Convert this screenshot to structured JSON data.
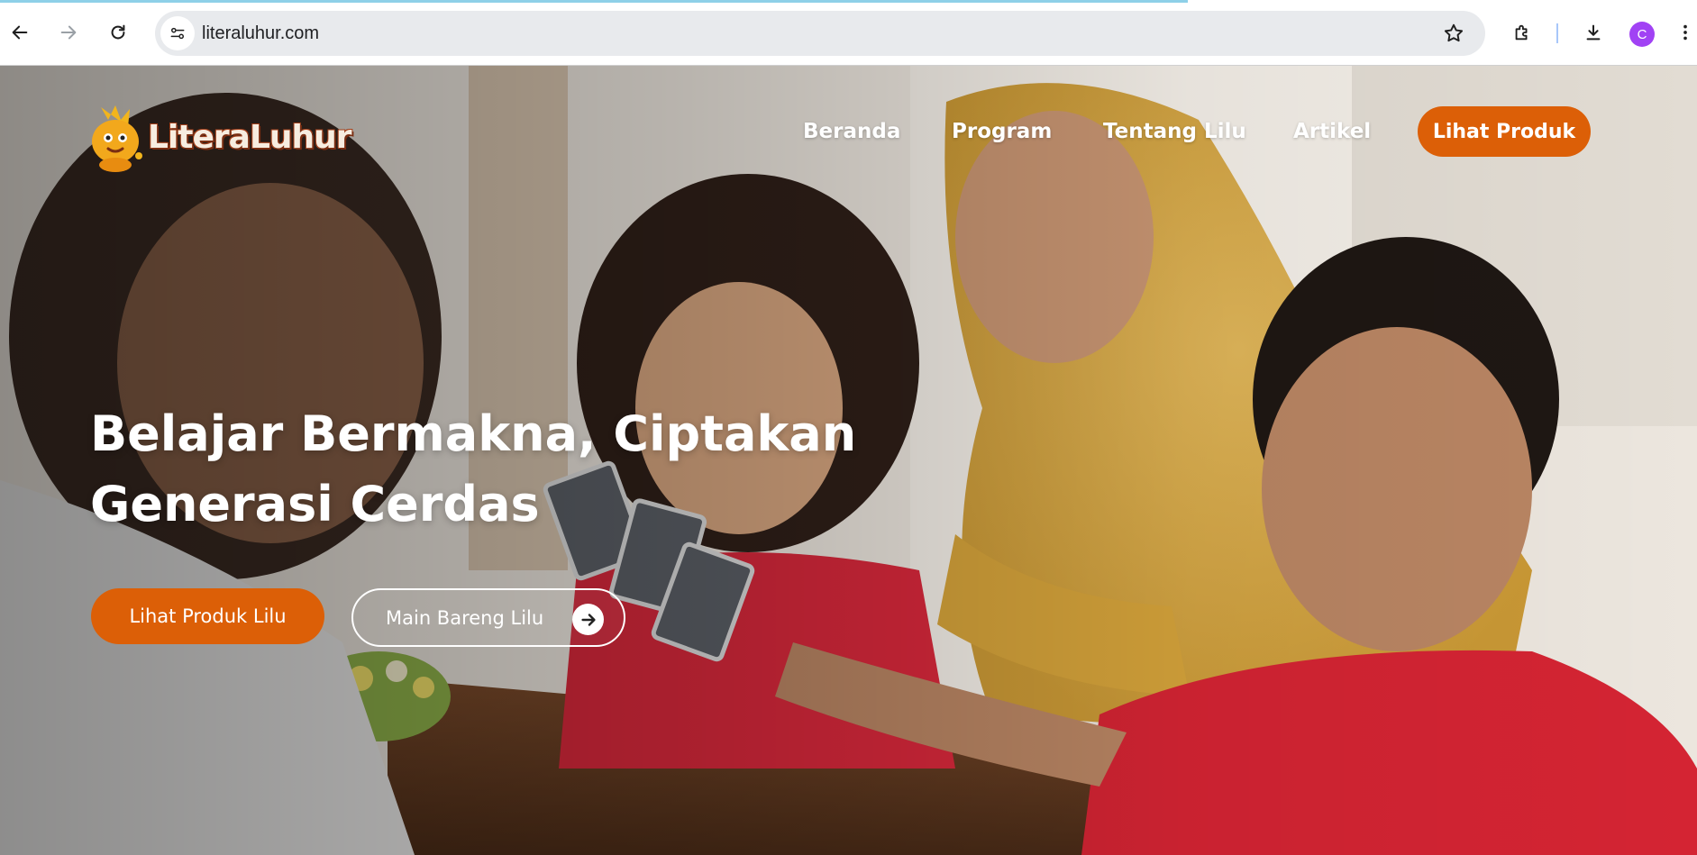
{
  "browser": {
    "url": "literaluhur.com",
    "profile_initial": "C",
    "icons": [
      "back-arrow-icon",
      "forward-arrow-icon",
      "reload-icon",
      "site-info-icon",
      "star-icon",
      "extensions-icon",
      "download-icon",
      "kebab-menu-icon"
    ]
  },
  "site": {
    "logo_text": "LiteraLuhur",
    "nav": [
      "Beranda",
      "Program",
      "Tentang Lilu",
      "Artikel"
    ],
    "nav_cta": "Lihat Produk",
    "headline": [
      "Belajar Bermakna, Ciptakan",
      "Generasi Cerdas"
    ],
    "primary_button": "Lihat Produk Lilu",
    "secondary_button": "Main Bareng Lilu",
    "accent_color": "#dc5f07"
  }
}
